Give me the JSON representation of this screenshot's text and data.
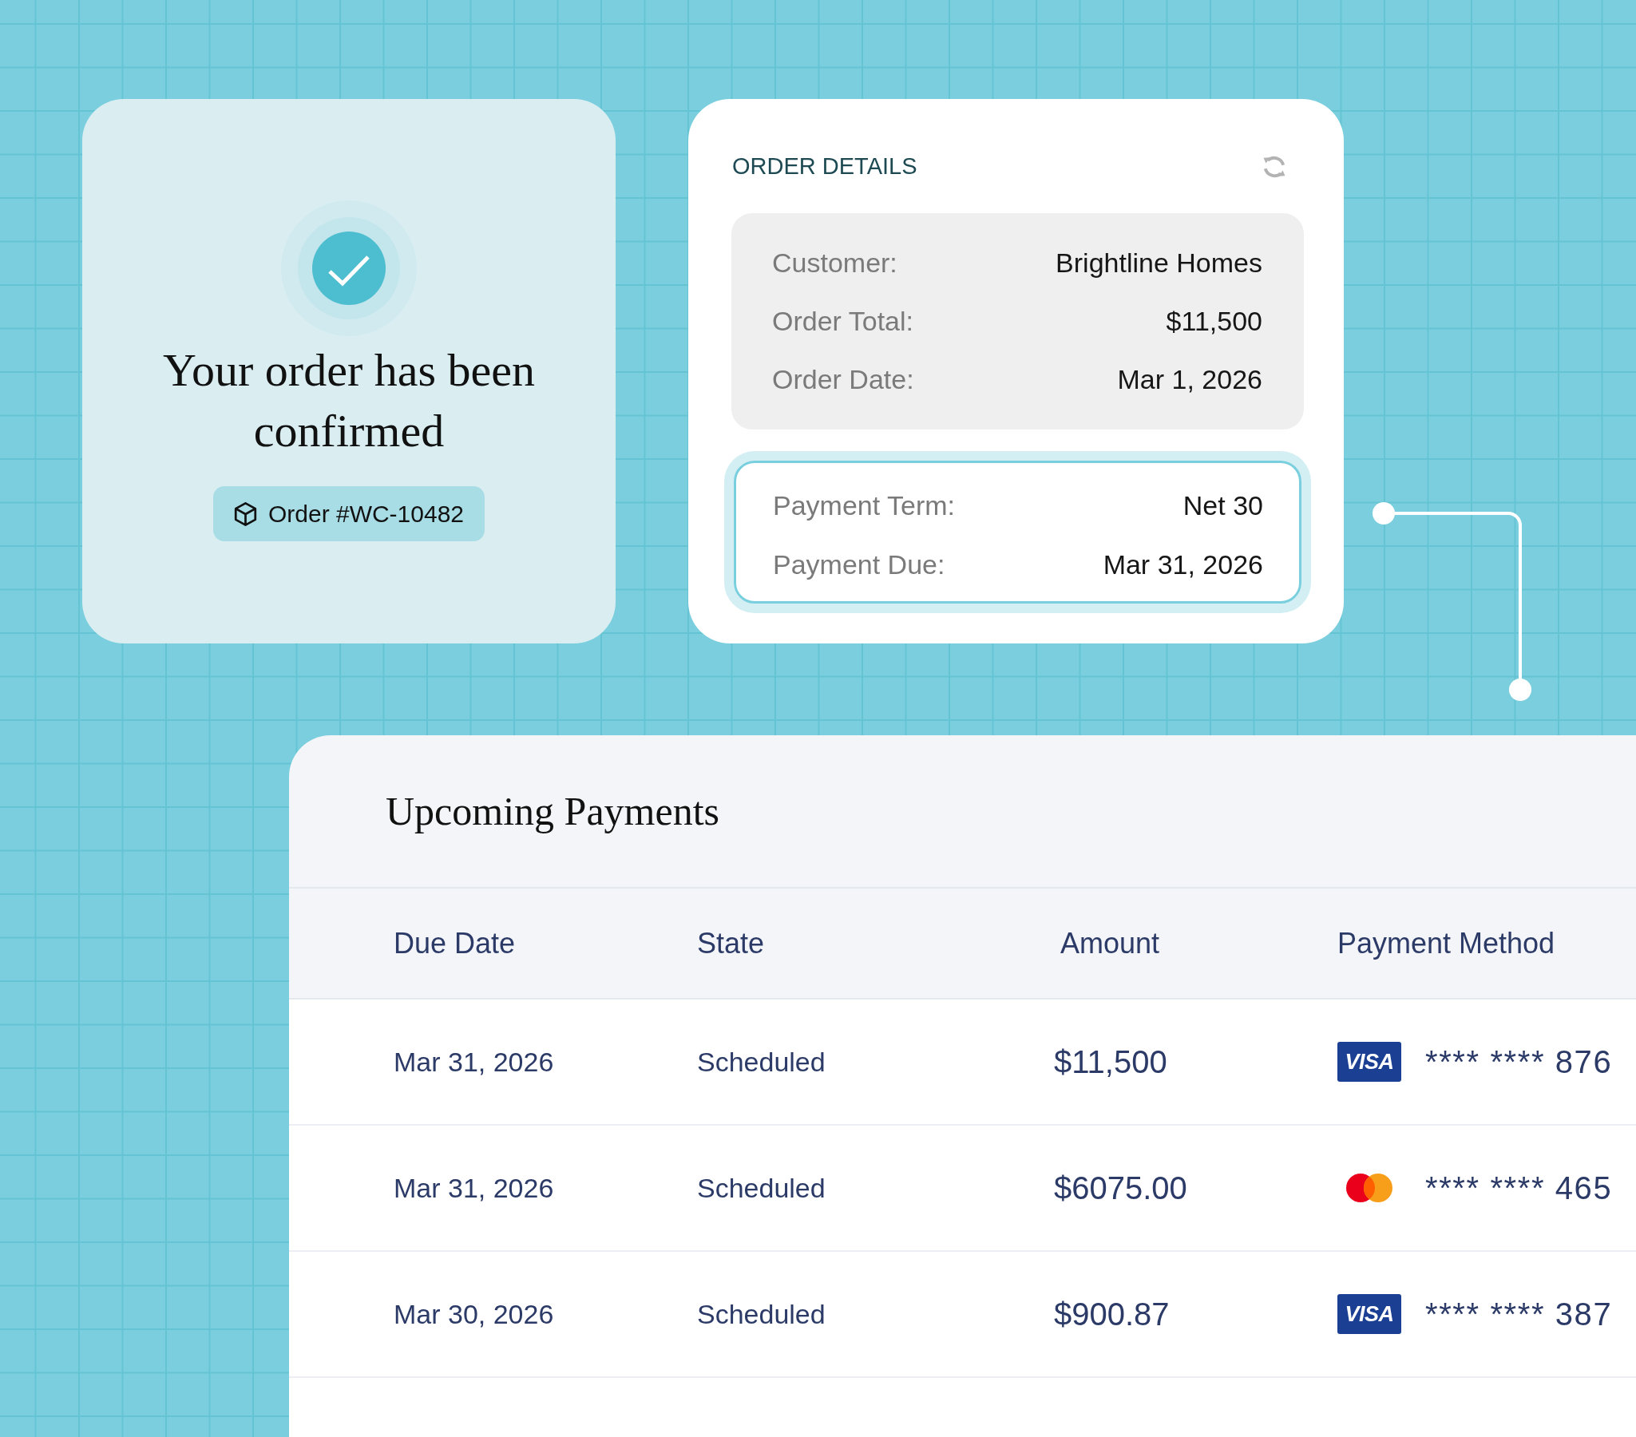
{
  "confirmation": {
    "title": "Your order has been confirmed",
    "order_number": "Order #WC-10482"
  },
  "order_details": {
    "title": "ORDER DETAILS",
    "summary": [
      {
        "label": "Customer:",
        "value": "Brightline Homes"
      },
      {
        "label": "Order Total:",
        "value": "$11,500"
      },
      {
        "label": "Order Date:",
        "value": "Mar 1, 2026"
      }
    ],
    "payment_terms": [
      {
        "label": "Payment Term:",
        "value": "Net 30"
      },
      {
        "label": "Payment Due:",
        "value": "Mar 31, 2026"
      }
    ]
  },
  "upcoming_payments": {
    "title": "Upcoming Payments",
    "columns": [
      "Due Date",
      "State",
      "Amount",
      "Payment Method"
    ],
    "rows": [
      {
        "due_date": "Mar 31, 2026",
        "state": "Scheduled",
        "amount": "$11,500",
        "payment_method": {
          "kind": "visa",
          "label": "VISA",
          "number": "**** **** 876"
        }
      },
      {
        "due_date": "Mar 31, 2026",
        "state": "Scheduled",
        "amount": "$6075.00",
        "payment_method": {
          "kind": "mastercard",
          "number": "**** **** 465"
        }
      },
      {
        "due_date": "Mar 30, 2026",
        "state": "Scheduled",
        "amount": "$900.87",
        "payment_method": {
          "kind": "visa",
          "label": "VISA",
          "number": "**** **** 387"
        }
      }
    ]
  }
}
